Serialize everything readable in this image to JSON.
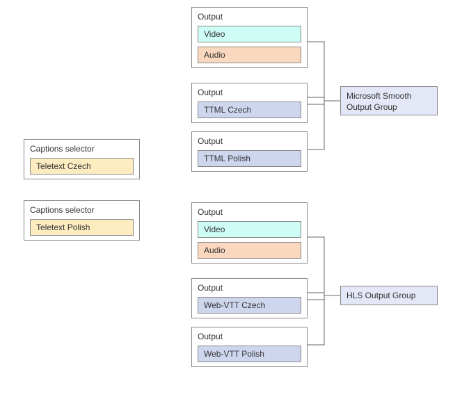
{
  "selectors": [
    {
      "title": "Captions selector",
      "item": "Teletext Czech"
    },
    {
      "title": "Captions selector",
      "item": "Teletext Polish"
    }
  ],
  "group1": {
    "outputs": [
      {
        "title": "Output",
        "items": [
          {
            "text": "Video",
            "cls": "cyan"
          },
          {
            "text": "Audio",
            "cls": "peach"
          }
        ]
      },
      {
        "title": "Output",
        "items": [
          {
            "text": "TTML Czech",
            "cls": "blue"
          }
        ]
      },
      {
        "title": "Output",
        "items": [
          {
            "text": "TTML Polish",
            "cls": "blue"
          }
        ]
      }
    ],
    "label": "Microsoft Smooth\nOutput Group"
  },
  "group2": {
    "outputs": [
      {
        "title": "Output",
        "items": [
          {
            "text": "Video",
            "cls": "cyan"
          },
          {
            "text": "Audio",
            "cls": "peach"
          }
        ]
      },
      {
        "title": "Output",
        "items": [
          {
            "text": "Web-VTT Czech",
            "cls": "blue"
          }
        ]
      },
      {
        "title": "Output",
        "items": [
          {
            "text": "Web-VTT Polish",
            "cls": "blue"
          }
        ]
      }
    ],
    "label": "HLS Output Group"
  },
  "chart_data": {
    "type": "table",
    "title": "Captions workflow diagram",
    "selectors": [
      {
        "name": "Captions selector",
        "value": "Teletext Czech"
      },
      {
        "name": "Captions selector",
        "value": "Teletext Polish"
      }
    ],
    "output_groups": [
      {
        "name": "Microsoft Smooth Output Group",
        "outputs": [
          {
            "name": "Output",
            "components": [
              "Video",
              "Audio"
            ]
          },
          {
            "name": "Output",
            "components": [
              "TTML Czech"
            ]
          },
          {
            "name": "Output",
            "components": [
              "TTML Polish"
            ]
          }
        ]
      },
      {
        "name": "HLS Output Group",
        "outputs": [
          {
            "name": "Output",
            "components": [
              "Video",
              "Audio"
            ]
          },
          {
            "name": "Output",
            "components": [
              "Web-VTT Czech"
            ]
          },
          {
            "name": "Output",
            "components": [
              "Web-VTT Polish"
            ]
          }
        ]
      }
    ]
  }
}
